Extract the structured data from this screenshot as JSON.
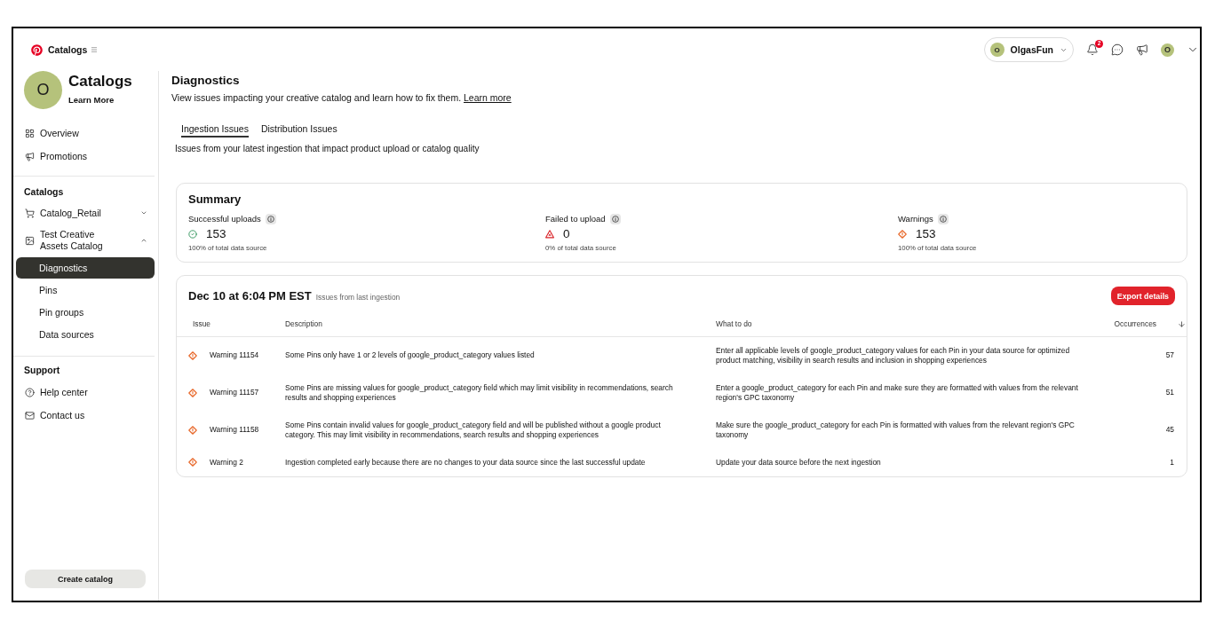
{
  "topbar": {
    "app_title": "Catalogs",
    "account": {
      "initial": "O",
      "name": "OlgasFun"
    },
    "notification_count": "2",
    "profile_initial": "O"
  },
  "sidebar": {
    "header": {
      "initial": "O",
      "title": "Catalogs",
      "link": "Learn More"
    },
    "nav": [
      {
        "label": "Overview",
        "selected": false
      },
      {
        "label": "Promotions",
        "selected": false
      }
    ],
    "catalogs": {
      "title": "Catalogs",
      "items": [
        {
          "label": "Catalog_Retail",
          "expanded": false
        },
        {
          "label": "Test Creative Assets Catalog",
          "expanded": true,
          "children": [
            {
              "label": "Diagnostics",
              "selected": true
            },
            {
              "label": "Pins",
              "selected": false
            },
            {
              "label": "Pin groups",
              "selected": false
            },
            {
              "label": "Data sources",
              "selected": false
            }
          ]
        }
      ]
    },
    "support": {
      "title": "Support",
      "items": [
        {
          "label": "Help center"
        },
        {
          "label": "Contact us"
        }
      ]
    },
    "create_button": "Create catalog"
  },
  "page": {
    "title": "Diagnostics",
    "description": "View issues impacting your creative catalog and learn how to fix them.",
    "link": "Learn more"
  },
  "tabs": [
    {
      "label": "Ingestion Issues",
      "selected": true
    },
    {
      "label": "Distribution Issues",
      "selected": false
    }
  ],
  "tab_description": "Issues from your latest ingestion that impact product upload or catalog quality",
  "summary": {
    "title": "Summary",
    "stats": [
      {
        "kind": "success",
        "label": "Successful uploads",
        "value": "153",
        "note": "100% of total data source"
      },
      {
        "kind": "failed",
        "label": "Failed to upload",
        "value": "0",
        "note": "0% of total data source"
      },
      {
        "kind": "warning",
        "label": "Warnings",
        "value": "153",
        "note": "100% of total data source"
      }
    ]
  },
  "ingestion": {
    "title": "Dec 10 at 6:04 PM EST",
    "subtitle": "Issues from last ingestion",
    "export_button": "Export details",
    "columns": [
      "Issue",
      "Description",
      "What to do",
      "Occurrences"
    ],
    "rows": [
      {
        "issue": "Warning 11154",
        "description": "Some Pins only have 1 or 2 levels of google_product_category values listed",
        "what_to_do": "Enter all applicable levels of google_product_category values for each Pin in your data source for optimized product matching, visibility in search results and inclusion in shopping experiences",
        "occurrences": "57"
      },
      {
        "issue": "Warning 11157",
        "description": "Some Pins are missing values for google_product_category field which may limit visibility in recommendations, search results and shopping experiences",
        "what_to_do": "Enter a google_product_category for each Pin and make sure they are formatted with values from the relevant region's GPC taxonomy",
        "occurrences": "51"
      },
      {
        "issue": "Warning 11158",
        "description": "Some Pins contain invalid values for google_product_category field and will be published without a google product category. This may limit visibility in recommendations, search results and shopping experiences",
        "what_to_do": "Make sure the google_product_category for each Pin is formatted with values from the relevant region's GPC taxonomy",
        "occurrences": "45"
      },
      {
        "issue": "Warning 2",
        "description": "Ingestion completed early because there are no changes to your data source since the last successful update",
        "what_to_do": "Update your data source before the next ingestion",
        "occurrences": "1"
      }
    ]
  }
}
